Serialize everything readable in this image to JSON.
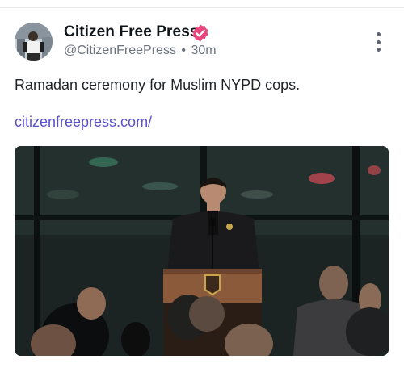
{
  "post": {
    "author_name": "Citizen Free Press",
    "handle": "@CitizenFreePress",
    "separator": "•",
    "time_ago": "30m",
    "text": "Ramadan ceremony for Muslim NYPD cops.",
    "link_text": "citizenfreepress.com/",
    "verified_badge_color": "#e8467c",
    "link_color": "#5a4fcf"
  },
  "icons": {
    "verified": "verified-badge-icon",
    "more": "more-options-icon"
  }
}
